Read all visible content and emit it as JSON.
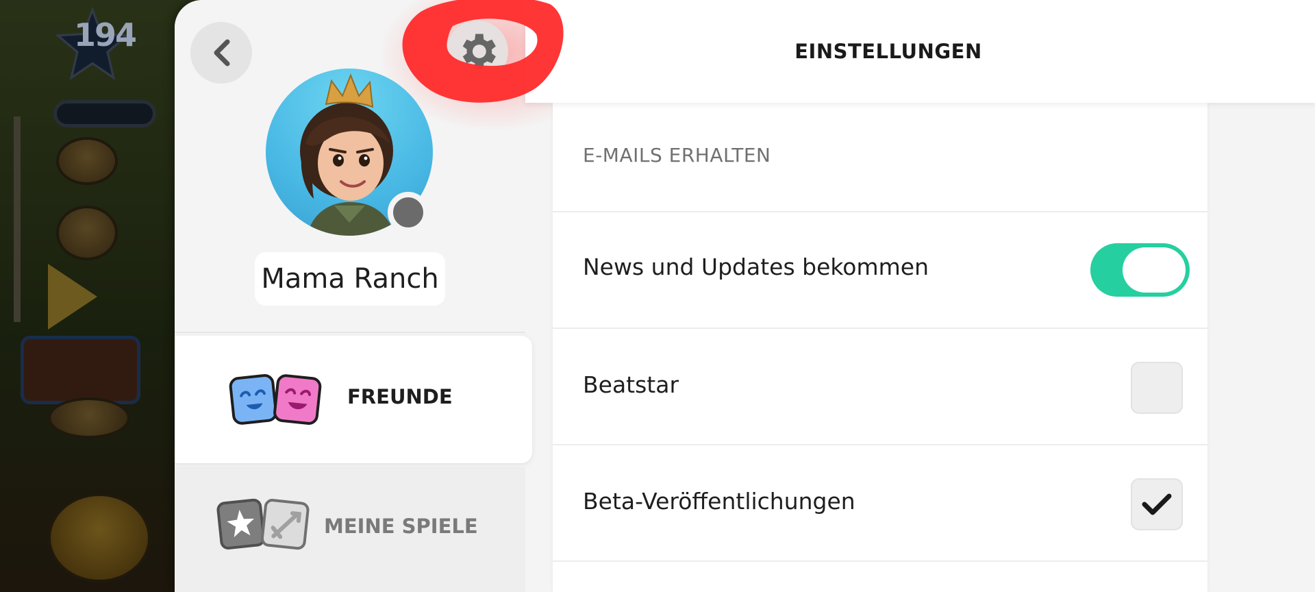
{
  "game_background": {
    "level": "194"
  },
  "sidebar": {
    "profile_name": "Mama Ranch",
    "tabs": [
      {
        "label": "FREUNDE",
        "active": true
      },
      {
        "label": "MEINE SPIELE",
        "active": false
      }
    ]
  },
  "header": {
    "title": "EINSTELLUNGEN"
  },
  "settings": {
    "section_title": "E-MAILS ERHALTEN",
    "rows": [
      {
        "label": "News und Updates bekommen",
        "control": "toggle",
        "checked": true
      },
      {
        "label": "Beatstar",
        "control": "checkbox",
        "checked": false
      },
      {
        "label": "Beta-Veröffentlichungen",
        "control": "checkbox",
        "checked": true
      }
    ]
  },
  "colors": {
    "accent_toggle": "#26cfa0",
    "scribble": "#ff2e2e",
    "friend_blue": "#7ab4f5",
    "friend_pink": "#f07ac8"
  },
  "icons": [
    "back-chevron-icon",
    "gear-icon",
    "friends-icon",
    "my-games-icon",
    "checkmark-icon"
  ]
}
